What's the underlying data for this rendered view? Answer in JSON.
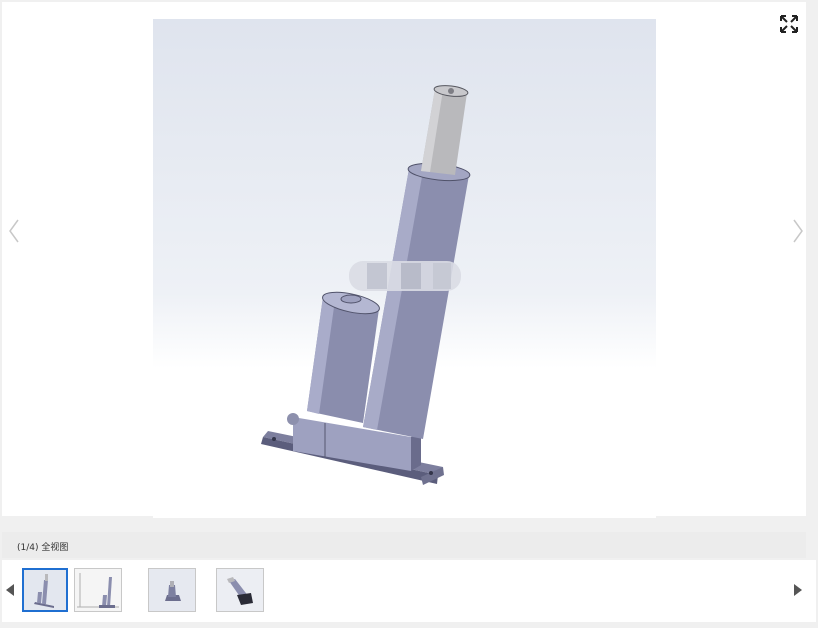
{
  "viewer": {
    "caption": "(1/4) 全视图",
    "current_index": 1,
    "total": 4
  },
  "icons": {
    "fullscreen": "fullscreen-icon",
    "prev": "chevron-left-icon",
    "next": "chevron-right-icon",
    "strip_prev": "triangle-left-icon",
    "strip_next": "triangle-right-icon"
  },
  "thumbnails": [
    {
      "label": "全视图",
      "active": true
    },
    {
      "label": "",
      "active": false
    },
    {
      "label": "",
      "active": false
    },
    {
      "label": "",
      "active": false
    }
  ],
  "colors": {
    "active_border": "#1f6fd1",
    "model_body": "#8f92b2",
    "rod": "#b9b9bc"
  }
}
